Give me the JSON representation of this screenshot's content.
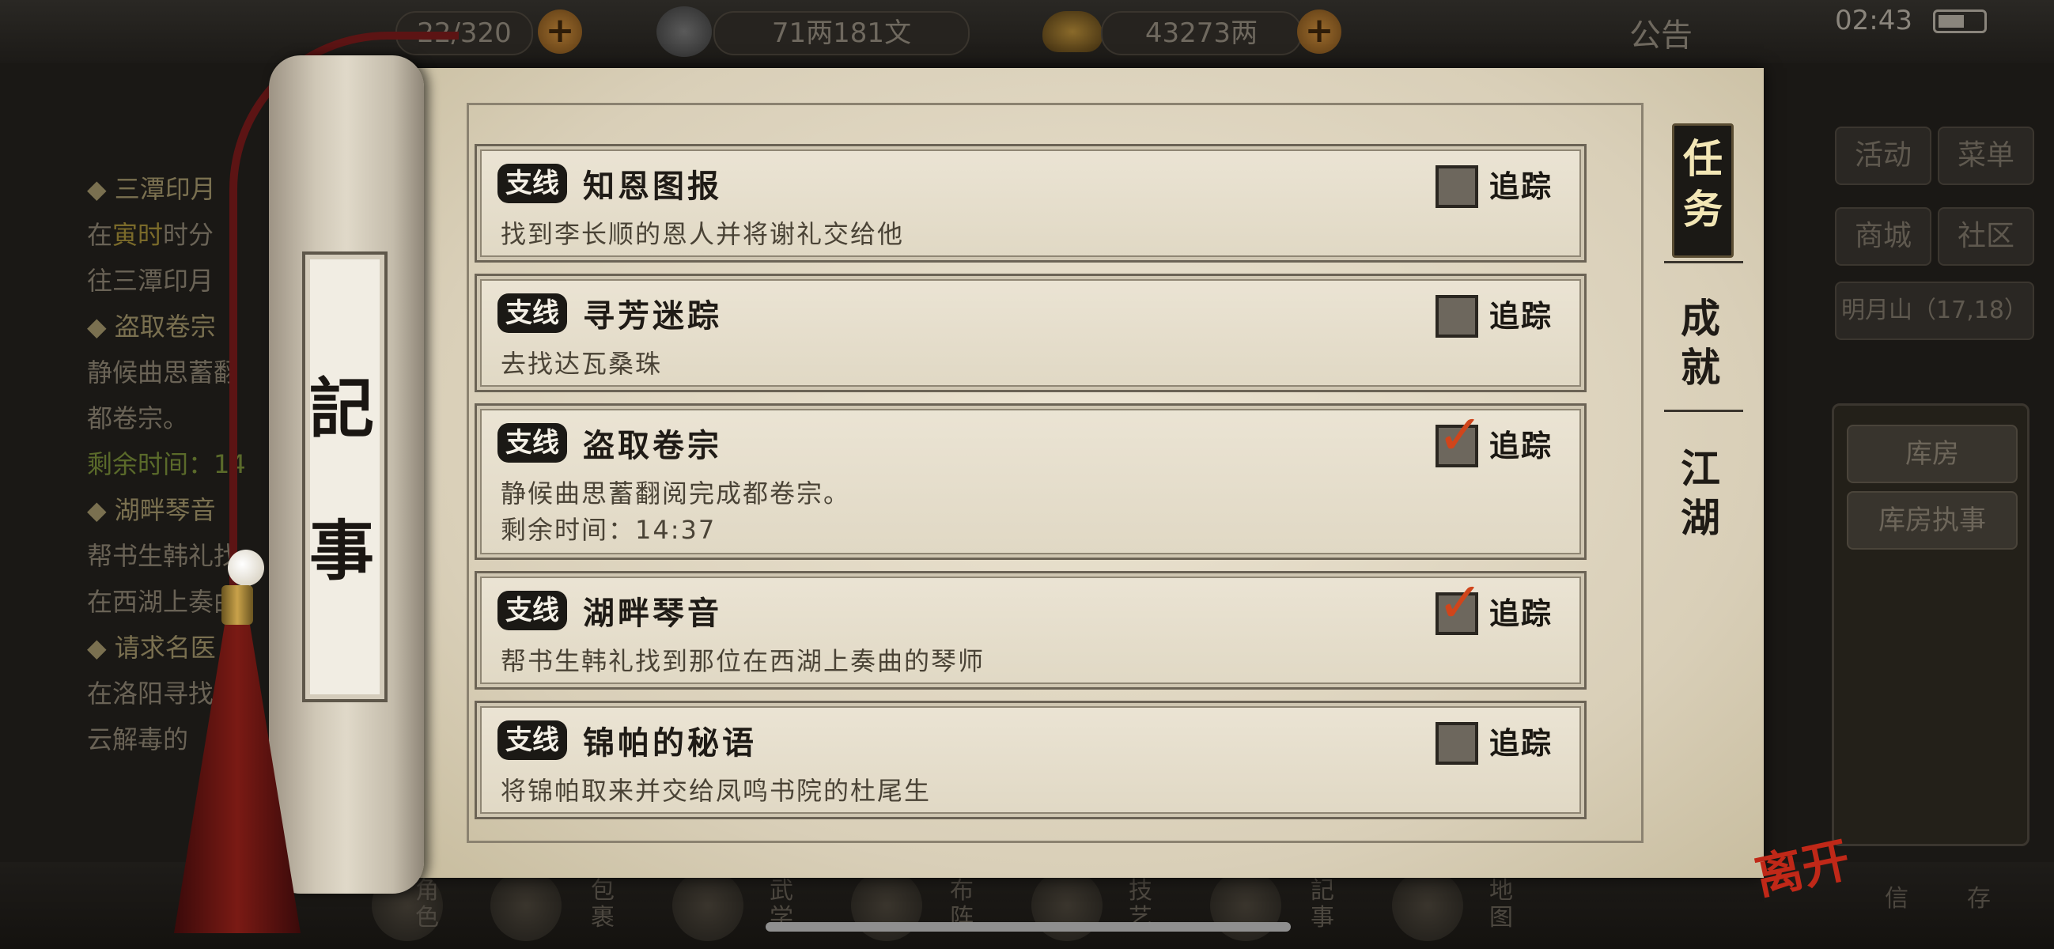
{
  "topbar": {
    "capacity": "22/320",
    "silver": "71两181文",
    "gold": "43273两",
    "notice": "公告",
    "time": "02:43"
  },
  "left_list": {
    "items": [
      {
        "title": "◆ 三潭印月",
        "line1a": "在",
        "line1b": "寅时",
        "line1c": "时分",
        "line2": "往三潭印月"
      },
      {
        "title": "◆ 盗取卷宗",
        "line1": "静候曲思蓄翻",
        "line2": "都卷宗。",
        "line3": "剩余时间：14"
      },
      {
        "title": "◆ 湖畔琴音",
        "line1": "帮书生韩礼找",
        "line2": "在西湖上奏曲"
      },
      {
        "title": "◆ 请求名医",
        "line1": "在洛阳寻找",
        "line2": "云解毒的"
      }
    ]
  },
  "right_panel": {
    "activity": "活动",
    "menu": "菜单",
    "mall": "商城",
    "community": "社区",
    "location": "明月山（17,18）",
    "warehouse": "库房",
    "warehouse_keeper": "库房执事"
  },
  "scroll": {
    "title_char1": "記",
    "title_char2": "事"
  },
  "tabs": {
    "task": "任务",
    "achievement": "成就",
    "jianghu": "江湖"
  },
  "quests": [
    {
      "badge": "支线",
      "title": "知恩图报",
      "desc": "找到李长顺的恩人并将谢礼交给他",
      "track_label": "追踪",
      "tracked": false
    },
    {
      "badge": "支线",
      "title": "寻芳迷踪",
      "desc": "去找达瓦桑珠",
      "track_label": "追踪",
      "tracked": false
    },
    {
      "badge": "支线",
      "title": "盗取卷宗",
      "desc": "静候曲思蓄翻阅完成都卷宗。",
      "desc2": "剩余时间：14:37",
      "track_label": "追踪",
      "tracked": true
    },
    {
      "badge": "支线",
      "title": "湖畔琴音",
      "desc": "帮书生韩礼找到那位在西湖上奏曲的琴师",
      "track_label": "追踪",
      "tracked": true
    },
    {
      "badge": "支线",
      "title": "锦帕的秘语",
      "desc": "将锦帕取来并交给凤鸣书院的杜尾生",
      "track_label": "追踪",
      "tracked": false
    }
  ],
  "bottom": {
    "role": "角色",
    "bag": "包裹",
    "skill": "武学",
    "layout": "布阵",
    "tech": "技艺",
    "notes": "記事",
    "map": "地图",
    "leave": "离开",
    "mail": "信",
    "save": "存"
  }
}
